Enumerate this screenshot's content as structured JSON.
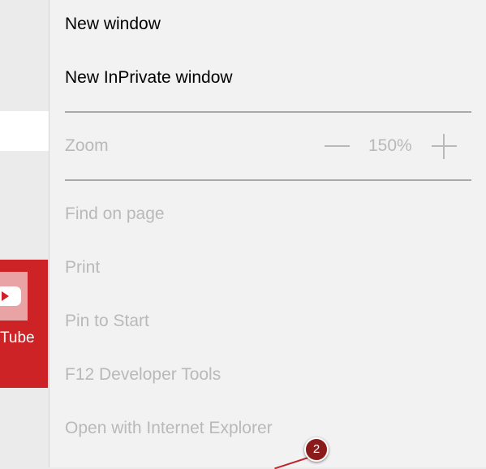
{
  "menu": {
    "items_top": [
      {
        "label": "New window",
        "enabled": true
      },
      {
        "label": "New InPrivate window",
        "enabled": true
      }
    ],
    "zoom": {
      "label": "Zoom",
      "value": "150%",
      "decrease_icon": "minus-icon",
      "increase_icon": "plus-icon"
    },
    "items_bottom": [
      {
        "label": "Find on page",
        "enabled": false
      },
      {
        "label": "Print",
        "enabled": false
      },
      {
        "label": "Pin to Start",
        "enabled": false
      },
      {
        "label": "F12 Developer Tools",
        "enabled": false
      },
      {
        "label": "Open with Internet Explorer",
        "enabled": false
      }
    ]
  },
  "background_tile": {
    "label": "Tube",
    "icon": "youtube-play-icon",
    "color": "#cd2326"
  },
  "callout": {
    "number": "2",
    "color": "#8b1a1a"
  }
}
